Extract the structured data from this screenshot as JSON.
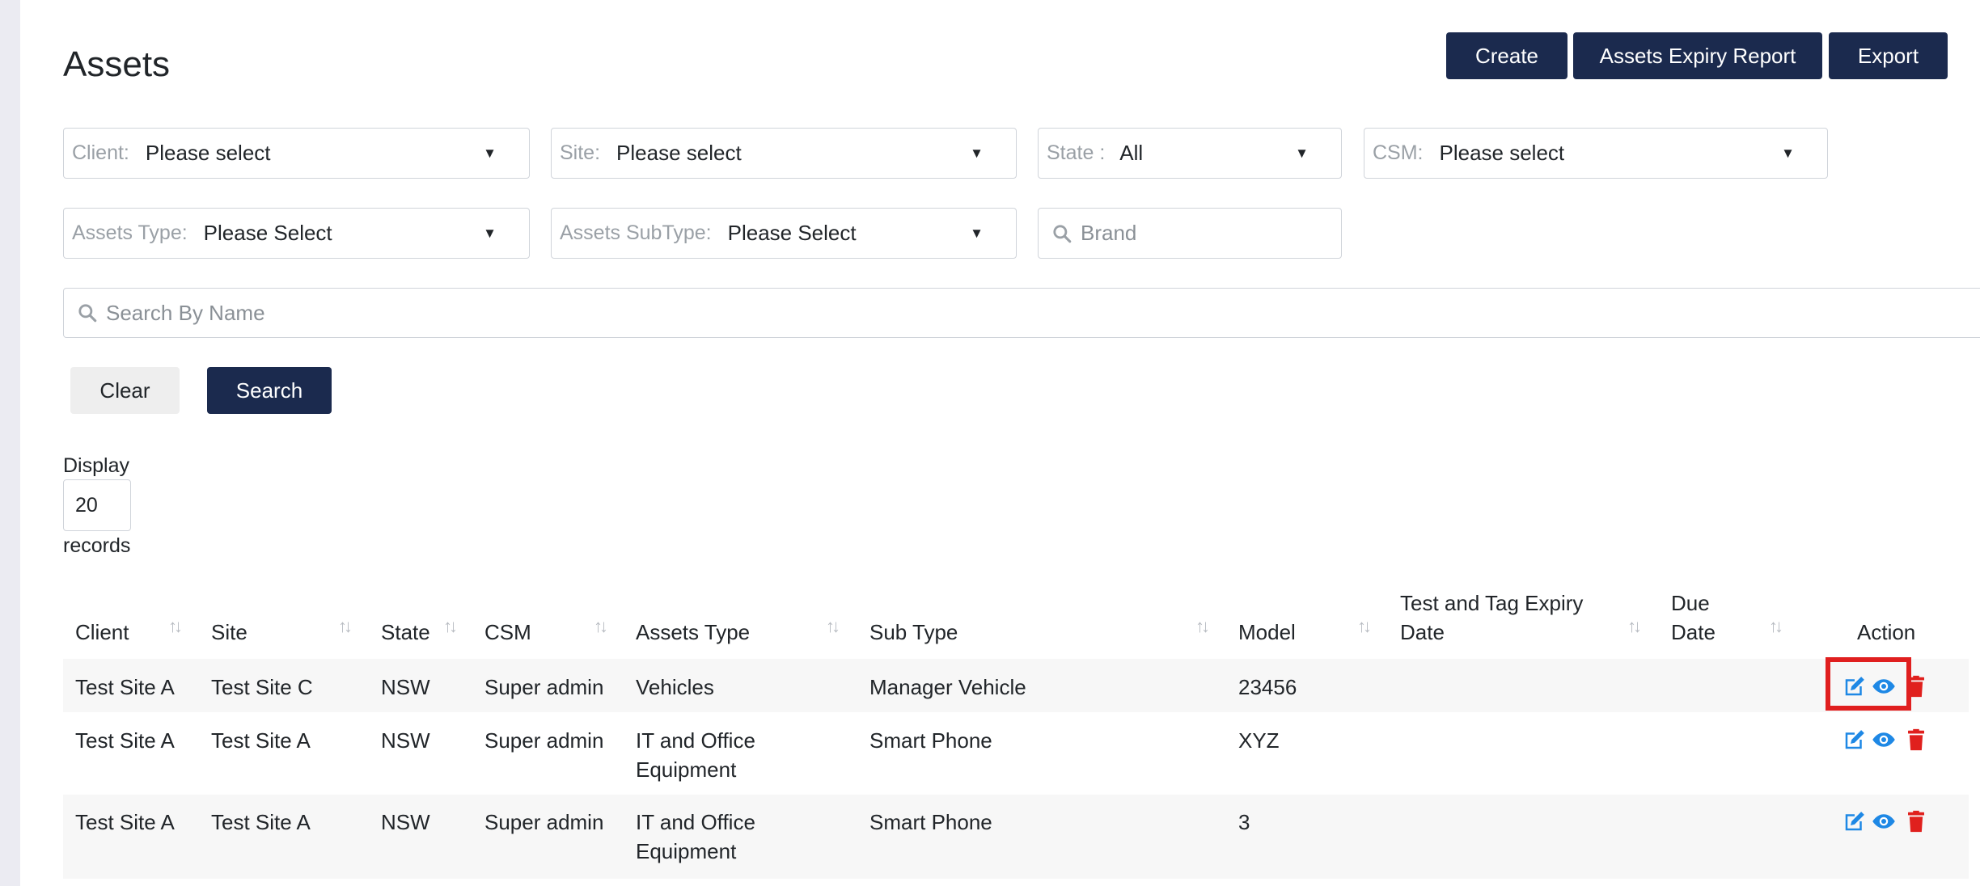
{
  "page": {
    "title": "Assets"
  },
  "toolbar": {
    "create": "Create",
    "expiry_report": "Assets Expiry Report",
    "export": "Export"
  },
  "filters": {
    "client": {
      "label": "Client:",
      "value": "Please select"
    },
    "site": {
      "label": "Site:",
      "value": "Please select"
    },
    "state": {
      "label": "State :",
      "value": "All"
    },
    "csm": {
      "label": "CSM:",
      "value": "Please select"
    },
    "assets_type": {
      "label": "Assets Type:",
      "value": "Please Select"
    },
    "assets_subtype": {
      "label": "Assets SubType:",
      "value": "Please Select"
    },
    "brand": {
      "placeholder": "Brand"
    },
    "search_name": {
      "placeholder": "Search By Name"
    },
    "caret_glyph": "▼"
  },
  "actions": {
    "clear": "Clear",
    "search": "Search"
  },
  "display": {
    "label": "Display",
    "value": "20",
    "suffix": "records"
  },
  "table": {
    "headers": {
      "client": "Client",
      "site": "Site",
      "state": "State",
      "csm": "CSM",
      "assets_type": "Assets Type",
      "sub_type": "Sub Type",
      "model": "Model",
      "test_tag_line1": "Test and Tag Expiry",
      "test_tag_line2": "Date",
      "due_line1": "Due",
      "due_line2": "Date",
      "action": "Action"
    },
    "sort_glyph": "↑↓",
    "rows": [
      {
        "client": "Test Site A",
        "site": "Test Site C",
        "state": "NSW",
        "csm": "Super admin",
        "type1": "Vehicles",
        "type2": "",
        "sub_type": "Manager Vehicle",
        "model": "23456"
      },
      {
        "client": "Test Site A",
        "site": "Test Site A",
        "state": "NSW",
        "csm": "Super admin",
        "type1": "IT and Office",
        "type2": "Equipment",
        "sub_type": "Smart Phone",
        "model": "XYZ"
      },
      {
        "client": "Test Site A",
        "site": "Test Site A",
        "state": "NSW",
        "csm": "Super admin",
        "type1": "IT and Office",
        "type2": "Equipment",
        "sub_type": "Smart Phone",
        "model": "3"
      }
    ],
    "row_action_icons": [
      "edit-icon",
      "eye-icon",
      "trash-icon"
    ]
  },
  "colors": {
    "primary": "#1b2a4e",
    "action_blue": "#1e88e5",
    "delete_red": "#e0201d",
    "highlight": "#e01f1f",
    "row_stripe": "#f7f7f7"
  }
}
